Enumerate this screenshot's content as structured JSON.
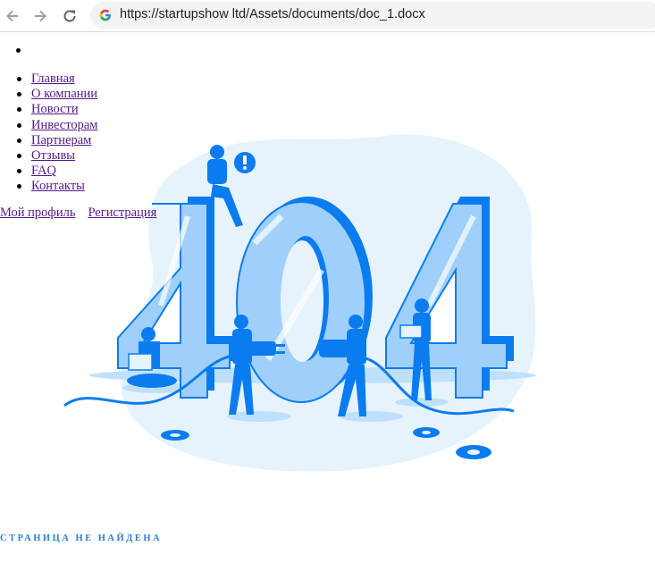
{
  "browser": {
    "url": "https://startupshow ltd/Assets/documents/doc_1.docx",
    "icons": {
      "back": "back-arrow-icon",
      "forward": "forward-arrow-icon",
      "reload": "reload-icon",
      "site": "google-g-icon"
    }
  },
  "menu": {
    "items": [
      {
        "label": "Главная"
      },
      {
        "label": "О компании"
      },
      {
        "label": "Новости"
      },
      {
        "label": "Инвесторам"
      },
      {
        "label": "Партнерам"
      },
      {
        "label": "Отзывы"
      },
      {
        "label": "FAQ"
      },
      {
        "label": "Контакты"
      }
    ]
  },
  "profile": {
    "my_profile": "Мой профиль",
    "register": "Регистрация"
  },
  "error": {
    "code": "404",
    "message": "СТРАНИЦА НЕ НАЙДЕНА"
  },
  "colors": {
    "accent": "#0a7cf0",
    "light_blue": "#9fd0fb",
    "pale_bg": "#e6f3fd",
    "link": "#551a8b",
    "message": "#2a7fd4"
  }
}
